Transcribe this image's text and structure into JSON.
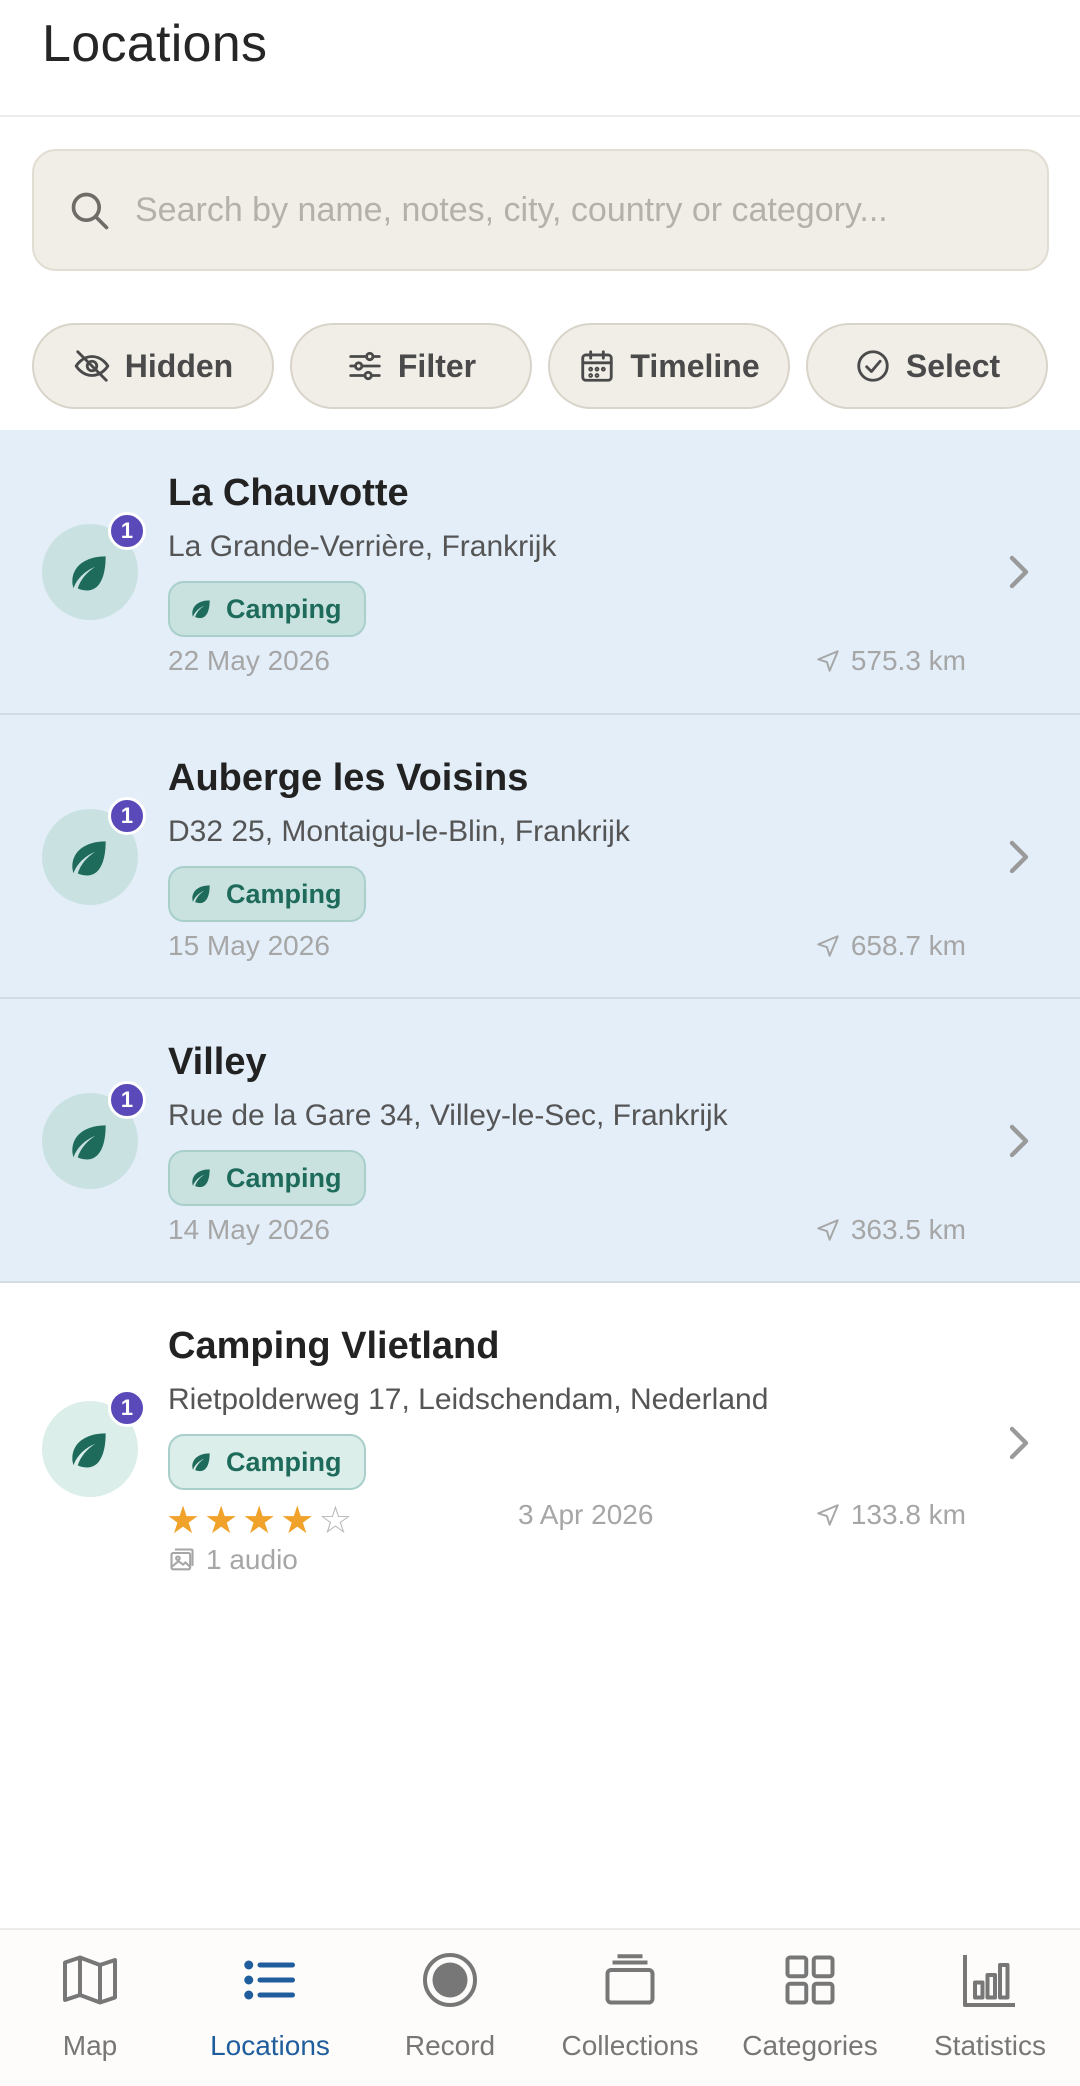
{
  "header": {
    "title": "Locations"
  },
  "search": {
    "placeholder": "Search by name, notes, city, country or category..."
  },
  "chips": [
    {
      "label": "Hidden",
      "icon": "eye-off-icon"
    },
    {
      "label": "Filter",
      "icon": "sliders-icon"
    },
    {
      "label": "Timeline",
      "icon": "calendar-icon"
    },
    {
      "label": "Select",
      "icon": "check-circle-icon"
    }
  ],
  "locations": [
    {
      "name": "La Chauvotte",
      "address": "La Grande-Verrière, Frankrijk",
      "category": "Camping",
      "date": "22 May 2026",
      "distance": "575.3 km",
      "badge": "1",
      "selected": true
    },
    {
      "name": "Auberge les Voisins",
      "address": "D32 25, Montaigu-le-Blin, Frankrijk",
      "category": "Camping",
      "date": "15 May 2026",
      "distance": "658.7 km",
      "badge": "1",
      "selected": true
    },
    {
      "name": "Villey",
      "address": "Rue de la Gare 34, Villey-le-Sec, Frankrijk",
      "category": "Camping",
      "date": "14 May 2026",
      "distance": "363.5 km",
      "badge": "1",
      "selected": true
    },
    {
      "name": "Camping Vlietland",
      "address": "Rietpolderweg 17, Leidschendam, Nederland",
      "category": "Camping",
      "date": "3 Apr 2026",
      "distance": "133.8 km",
      "badge": "1",
      "selected": false,
      "rating": 4,
      "rating_max": 5,
      "media": "1 audio"
    }
  ],
  "nav": [
    {
      "label": "Map",
      "icon": "map-icon",
      "active": false
    },
    {
      "label": "Locations",
      "icon": "list-icon",
      "active": true
    },
    {
      "label": "Record",
      "icon": "record-icon",
      "active": false
    },
    {
      "label": "Collections",
      "icon": "collections-icon",
      "active": false
    },
    {
      "label": "Categories",
      "icon": "grid-icon",
      "active": false
    },
    {
      "label": "Statistics",
      "icon": "bar-chart-icon",
      "active": false
    }
  ],
  "colors": {
    "accent": "#1f5d9c",
    "selected_row": "#e3eef9",
    "tag_green": "#1e6b5c",
    "badge": "#5a49b8",
    "star": "#f0a22b"
  }
}
